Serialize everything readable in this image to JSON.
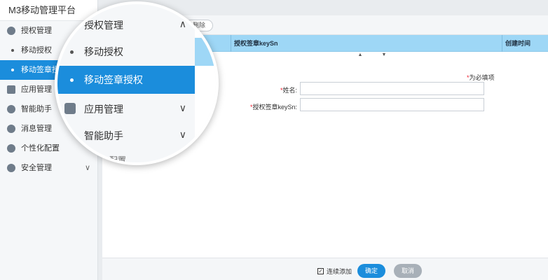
{
  "app": {
    "title": "M3移动管理平台"
  },
  "sidebar": {
    "items": [
      {
        "label": "授权管理",
        "icon": "gear-icon",
        "expanded": true
      },
      {
        "label": "移动授权",
        "sub": true
      },
      {
        "label": "移动签章授权",
        "sub": true,
        "active": true
      },
      {
        "label": "应用管理",
        "icon": "cube-icon"
      },
      {
        "label": "智能助手",
        "icon": "bulb-icon"
      },
      {
        "label": "消息管理",
        "icon": "bell-icon"
      },
      {
        "label": "个性化配置",
        "icon": "palette-icon"
      },
      {
        "label": "安全管理",
        "icon": "shield-icon",
        "chevron": "∨"
      }
    ]
  },
  "toolbar": {
    "delete_label": "删除"
  },
  "table": {
    "columns": [
      "授权签章keySn",
      "创建时间"
    ],
    "sort_up": "▲",
    "sort_down": "▼"
  },
  "form": {
    "required_note": "为必填项",
    "required_mark": "*",
    "fields": [
      {
        "label": "姓名:",
        "value": ""
      },
      {
        "label": "授权签章keySn:",
        "value": ""
      }
    ]
  },
  "footer": {
    "continuous_add_label": "连续添加",
    "continuous_add_checked": true,
    "ok_label": "确定",
    "cancel_label": "取消"
  },
  "magnifier": {
    "header": "授权管理",
    "header_chevron": "∧",
    "sub1": "移动授权",
    "sub2": "移动签章授权",
    "item3": "应用管理",
    "item4": "智能助手",
    "item_chevron": "∨",
    "partial": "个性化配置"
  },
  "colors": {
    "accent": "#1b8ddc",
    "header_bg": "#9ed7f6",
    "required": "#ee2233"
  }
}
